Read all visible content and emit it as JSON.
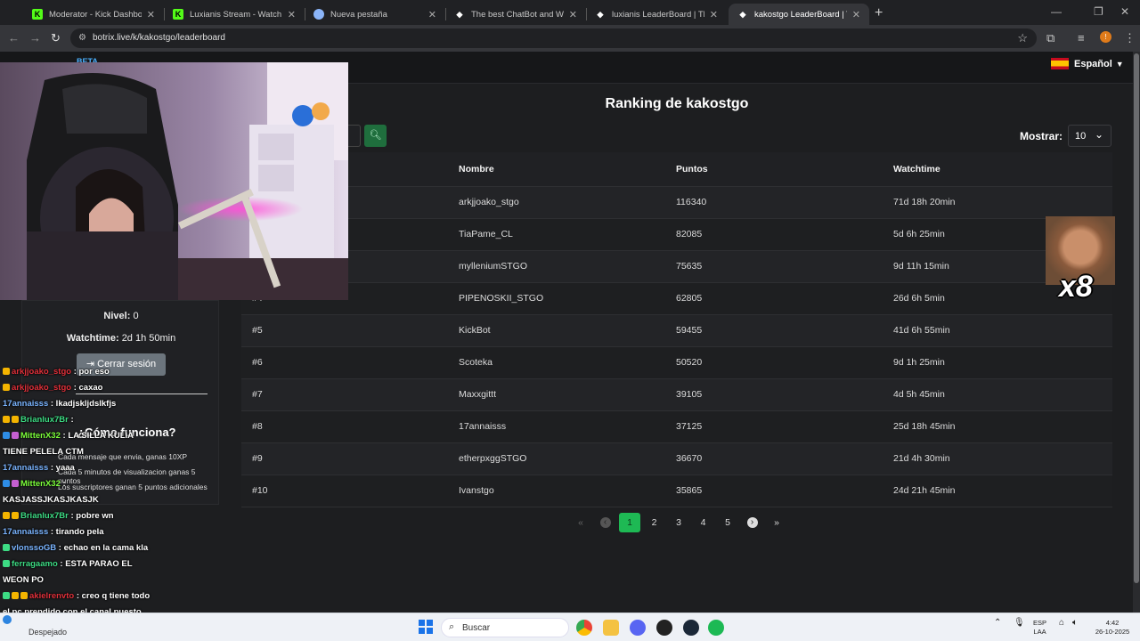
{
  "browser": {
    "tabs": [
      {
        "title": "Moderator - Kick Dashboard",
        "icon": "kick-icon",
        "active": false
      },
      {
        "title": "Luxianis Stream - Watch Live on Kick",
        "icon": "kick-icon",
        "active": false
      },
      {
        "title": "Nueva pestaña",
        "icon": "chrome-icon",
        "active": false
      },
      {
        "title": "The best ChatBot and Widgets for Kick",
        "icon": "botrix-icon",
        "active": false
      },
      {
        "title": "luxianis LeaderBoard | The best ChatBot",
        "icon": "botrix-icon",
        "active": false
      },
      {
        "title": "kakostgo LeaderBoard | The best ChatBot",
        "icon": "botrix-icon",
        "active": true
      }
    ],
    "url": "botrix.live/k/kakostgo/leaderboard",
    "profile_initial": "!"
  },
  "site": {
    "beta_label": "BETA",
    "language": "Español",
    "ranking_title": "Ranking de kakostgo",
    "mostrar_label": "Mostrar:",
    "page_size": "10",
    "columns": [
      "Nombre",
      "Puntos",
      "Watchtime"
    ],
    "rows": [
      {
        "rank": "",
        "name": "arkjjoako_stgo",
        "points": "116340",
        "watchtime": "71d 18h 20min"
      },
      {
        "rank": "",
        "name": "TiaPame_CL",
        "points": "82085",
        "watchtime": "5d 6h 25min"
      },
      {
        "rank": "#3",
        "name": "mylleniumSTGO",
        "points": "75635",
        "watchtime": "9d 11h 15min"
      },
      {
        "rank": "#4",
        "name": "PIPENOSKII_STGO",
        "points": "62805",
        "watchtime": "26d 6h 5min"
      },
      {
        "rank": "#5",
        "name": "KickBot",
        "points": "59455",
        "watchtime": "41d 6h 55min"
      },
      {
        "rank": "#6",
        "name": "Scoteka",
        "points": "50520",
        "watchtime": "9d 1h 25min"
      },
      {
        "rank": "#7",
        "name": "Maxxgittt",
        "points": "39105",
        "watchtime": "4d 5h 45min"
      },
      {
        "rank": "#8",
        "name": "17annaisss",
        "points": "37125",
        "watchtime": "25d 18h 45min"
      },
      {
        "rank": "#9",
        "name": "etherpxggSTGO",
        "points": "36670",
        "watchtime": "21d 4h 30min"
      },
      {
        "rank": "#10",
        "name": "Ivanstgo",
        "points": "35865",
        "watchtime": "24d 21h 45min"
      }
    ],
    "pagination": {
      "first": "«",
      "prev": "‹",
      "pages": [
        "1",
        "2",
        "3",
        "4",
        "5"
      ],
      "active_page": "1",
      "next": "›",
      "last": "»"
    },
    "user_panel": {
      "nivel_label": "Nivel:",
      "nivel_value": "0",
      "watchtime_label": "Watchtime:",
      "watchtime_value": "2d 1h 50min",
      "logout_label": "Cerrar sesión",
      "how_title": "¿Cómo funciona?",
      "how_items": [
        "Cada mensaje que envia, ganas 10XP",
        "Cada 5 minutos de visualizacion ganas 5 puntos",
        "Los suscriptores ganan 5 puntos adicionales"
      ]
    }
  },
  "stream_overlay": {
    "meme_text": "x8",
    "chat": [
      {
        "user": "arkjjoako_stgo",
        "color": "#e0303a",
        "text": ": por eso",
        "badges": [
          "#f4b400"
        ]
      },
      {
        "user": "arkjjoako_stgo",
        "color": "#e0303a",
        "text": ": caxao",
        "badges": [
          "#f4b400"
        ]
      },
      {
        "user": "17annaisss",
        "color": "#7ab4ff",
        "text": ": lkadjskljdslkfjs",
        "badges": []
      },
      {
        "user": "Brianlux7Br",
        "color": "#3ddc84",
        "text": ":",
        "badges": [
          "#f4b400",
          "#f4b400"
        ]
      },
      {
        "user": "MittenX32",
        "color": "#7cff3b",
        "text": ": LA SILLA KULIA",
        "badges": [
          "#2e8de6",
          "#c55fd0"
        ]
      },
      {
        "user": "",
        "color": "#fff",
        "text": "TIENE PELELA CTM",
        "badges": []
      },
      {
        "user": "17annaisss",
        "color": "#7ab4ff",
        "text": ": yaaa",
        "badges": []
      },
      {
        "user": "MittenX32",
        "color": "#7cff3b",
        "text": ":",
        "badges": [
          "#2e8de6",
          "#c55fd0"
        ]
      },
      {
        "user": "",
        "color": "#fff",
        "text": "KASJASSJKASJKASJK",
        "badges": []
      },
      {
        "user": "Brianlux7Br",
        "color": "#3ddc84",
        "text": ": pobre wn",
        "badges": [
          "#f4b400",
          "#f4b400"
        ]
      },
      {
        "user": "17annaisss",
        "color": "#7ab4ff",
        "text": ": tirando pela",
        "badges": []
      },
      {
        "user": "vlonssoGB",
        "color": "#7ab4ff",
        "text": ": echao en la cama kla",
        "badges": [
          "#3ddc84"
        ]
      },
      {
        "user": "ferragaamo",
        "color": "#3ddc84",
        "text": ": ESTA PARAO EL",
        "badges": [
          "#3ddc84"
        ]
      },
      {
        "user": "",
        "color": "#fff",
        "text": "WEON PO",
        "badges": []
      },
      {
        "user": "akielrenvto",
        "color": "#e0303a",
        "text": ": creo q tiene todo",
        "badges": [
          "#3ddc84",
          "#f4b400",
          "#f4b400"
        ]
      },
      {
        "user": "",
        "color": "#fff",
        "text": "el pc prendido con el canal puesto",
        "badges": []
      },
      {
        "user": "ferragaamo",
        "color": "#3ddc84",
        "text": ": ESTA PARAO EL",
        "badges": [
          "#3ddc84"
        ]
      },
      {
        "user": "",
        "color": "#fff",
        "text": "WEON PO",
        "badges": []
      }
    ]
  },
  "taskbar": {
    "weather": "Despejado",
    "search_placeholder": "Buscar",
    "lang_line1": "ESP",
    "lang_line2": "LAA",
    "time": "4:42",
    "date": "26-10-2025"
  },
  "colors": {
    "accent_green": "#1eb954",
    "link_blue": "#4ab1ff"
  }
}
